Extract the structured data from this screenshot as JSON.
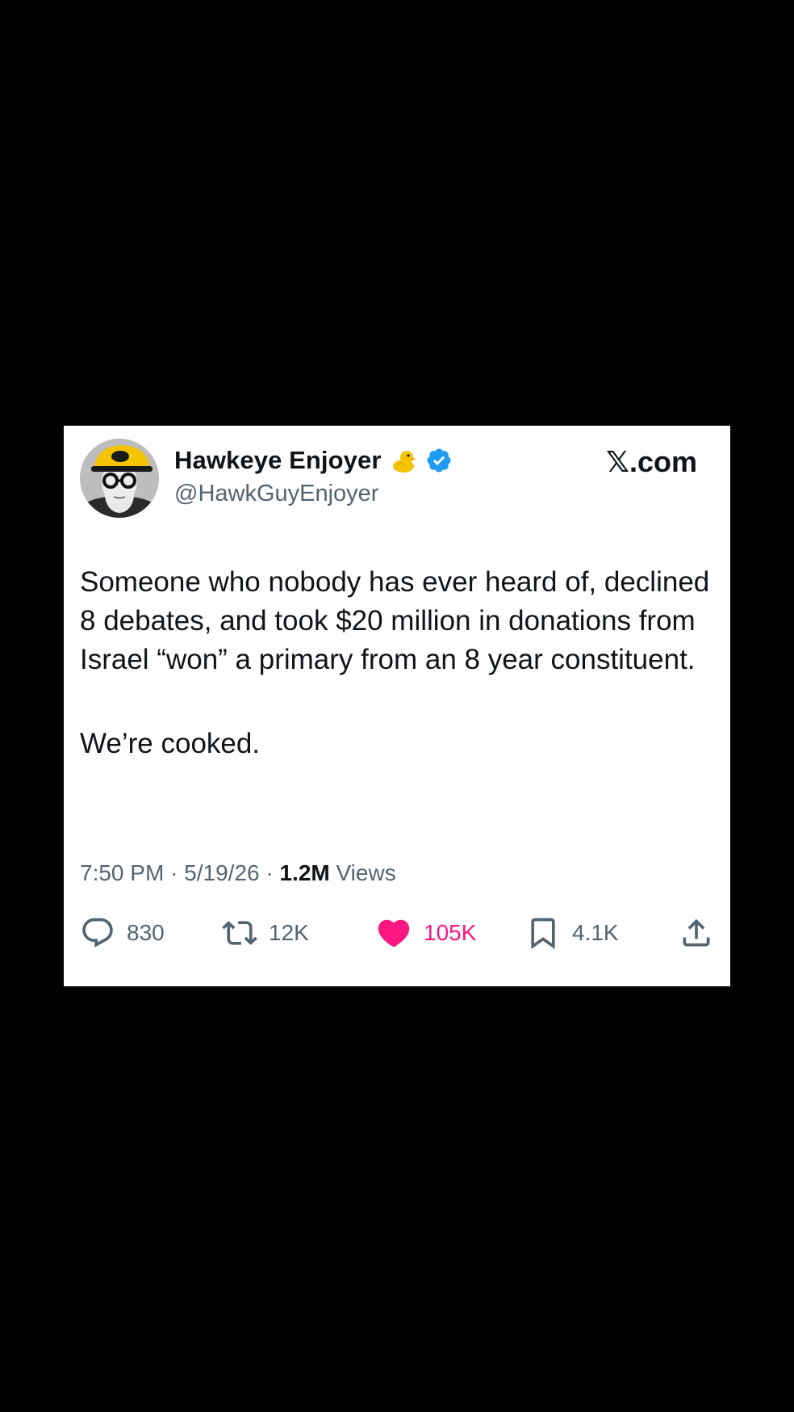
{
  "post": {
    "author": {
      "display_name": "Hawkeye Enjoyer",
      "handle": "@HawkGuyEnjoyer",
      "emoji_badge": "duck-icon",
      "verified": true
    },
    "site_label": "𝕏.com",
    "body": {
      "paragraph_1": "Someone who nobody has ever heard of, declined 8 debates, and took $20 million in donations from Israel “won” a primary from an 8 year constituent.",
      "paragraph_2": "We’re cooked."
    },
    "meta": {
      "time": "7:50 PM",
      "separator": "·",
      "date": "5/19/26",
      "views_count": "1.2M",
      "views_label": "Views"
    },
    "actions": {
      "replies": "830",
      "reposts": "12K",
      "likes": "105K",
      "bookmarks": "4.1K"
    },
    "colors": {
      "background": "#000000",
      "card": "#ffffff",
      "text_primary": "#0f1419",
      "text_secondary": "#536471",
      "like_pink": "#f91880",
      "verified_blue": "#1d9bf0",
      "hat_yellow": "#f5c400"
    }
  }
}
